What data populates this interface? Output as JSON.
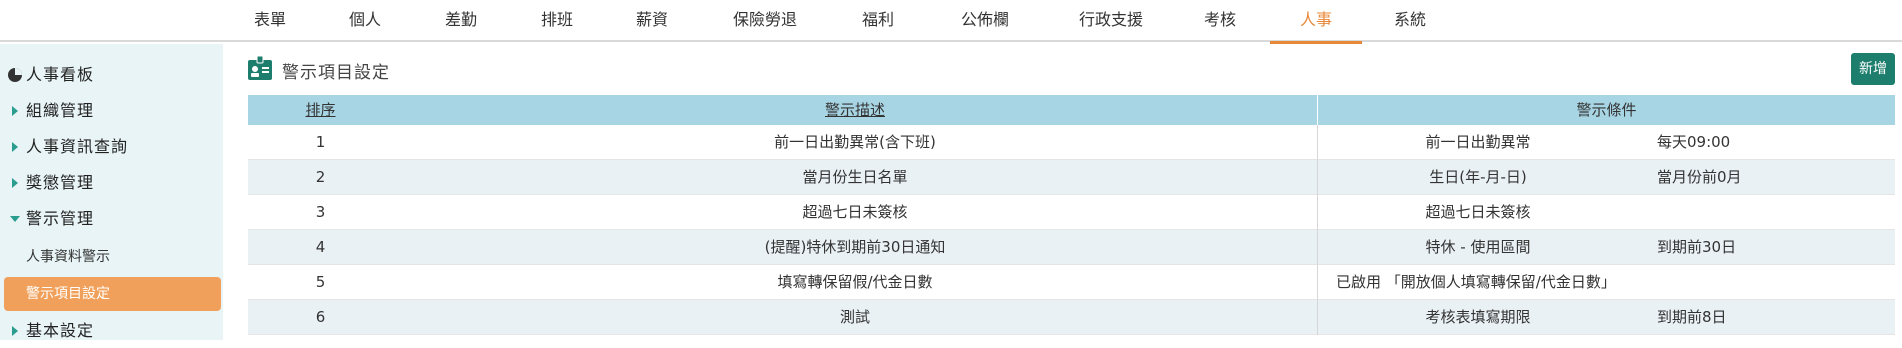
{
  "topnav": {
    "tabs": [
      {
        "label": "表單"
      },
      {
        "label": "個人"
      },
      {
        "label": "差勤"
      },
      {
        "label": "排班"
      },
      {
        "label": "薪資"
      },
      {
        "label": "保險勞退"
      },
      {
        "label": "福利"
      },
      {
        "label": "公佈欄"
      },
      {
        "label": "行政支援"
      },
      {
        "label": "考核"
      },
      {
        "label": "人事"
      },
      {
        "label": "系統"
      }
    ],
    "active": "人事",
    "accent_color": "#e8893a"
  },
  "sidebar": {
    "items": [
      {
        "label": "人事看板",
        "icon": "pie-chart-icon"
      },
      {
        "label": "組織管理",
        "icon": "caret-right-icon"
      },
      {
        "label": "人事資訊查詢",
        "icon": "caret-right-icon"
      },
      {
        "label": "獎懲管理",
        "icon": "caret-right-icon"
      },
      {
        "label": "警示管理",
        "icon": "caret-down-icon"
      },
      {
        "label": "基本設定",
        "icon": "caret-right-icon"
      }
    ],
    "subitems": [
      {
        "label": "人事資料警示"
      },
      {
        "label": "警示項目設定"
      }
    ],
    "active_subitem": "警示項目設定",
    "active_color": "#f0a05a"
  },
  "main": {
    "title": "警示項目設定",
    "title_icon": "id-card-icon",
    "add_label": "新增",
    "add_color": "#1e7e6e"
  },
  "table": {
    "headers": {
      "order": "排序",
      "description": "警示描述",
      "condition": "警示條件"
    },
    "rows": [
      {
        "order": "1",
        "description": "前一日出勤異常(含下班)",
        "condition": "前一日出勤異常",
        "condition_value": "每天09:00"
      },
      {
        "order": "2",
        "description": "當月份生日名單",
        "condition": "生日(年-月-日)",
        "condition_value": "當月份前0月"
      },
      {
        "order": "3",
        "description": "超過七日未簽核",
        "condition": "超過七日未簽核",
        "condition_value": ""
      },
      {
        "order": "4",
        "description": "(提醒)特休到期前30日通知",
        "condition": "特休 - 使用區間",
        "condition_value": "到期前30日"
      },
      {
        "order": "5",
        "description": "填寫轉保留假/代金日數",
        "condition": "已啟用 「開放個人填寫轉保留/代金日數」",
        "condition_value": ""
      },
      {
        "order": "6",
        "description": "測試",
        "condition": "考核表填寫期限",
        "condition_value": "到期前8日"
      }
    ],
    "header_color": "#a8d5e4",
    "alt_row_color": "#eaf1f5"
  }
}
